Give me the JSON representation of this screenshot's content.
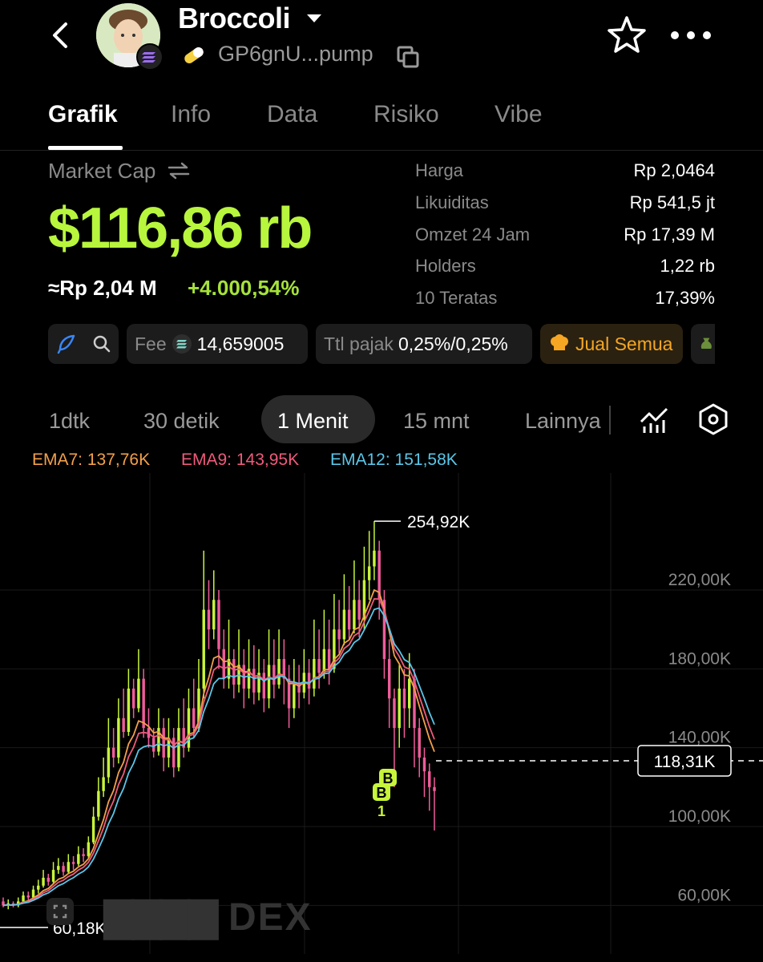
{
  "header": {
    "title": "Broccoli",
    "address": "GP6gnU...pump",
    "icons": {
      "back": "chevron-left-icon",
      "star": "star-icon",
      "more": "more-horizontal-icon",
      "copy": "copy-icon",
      "pill": "pill-icon"
    }
  },
  "tabs": [
    {
      "label": "Grafik",
      "active": true
    },
    {
      "label": "Info"
    },
    {
      "label": "Data"
    },
    {
      "label": "Risiko"
    },
    {
      "label": "Vibe"
    }
  ],
  "market": {
    "label": "Market Cap",
    "value": "$116,86 rb",
    "idr": "≈Rp 2,04 M",
    "change": "+4.000,54%"
  },
  "stats": [
    {
      "key": "Harga",
      "value": "Rp 2,0464"
    },
    {
      "key": "Likuiditas",
      "value": "Rp 541,5 jt"
    },
    {
      "key": "Omzet 24 Jam",
      "value": "Rp 17,39 M"
    },
    {
      "key": "Holders",
      "value": "1,22 rb"
    },
    {
      "key": "10 Teratas",
      "value": "17,39%"
    }
  ],
  "chips": {
    "fee_label": "Fee",
    "fee_value": "14,659005",
    "tax_label": "Ttl pajak",
    "tax_value": "0,25%/0,25%",
    "sell_all": "Jual Semua"
  },
  "timeframes": [
    {
      "label": "1dtk"
    },
    {
      "label": "30 detik"
    },
    {
      "label": "1 Menit",
      "active": true
    },
    {
      "label": "15 mnt"
    },
    {
      "label": "Lainnya"
    }
  ],
  "ema": {
    "ema7": "EMA7: 137,76K",
    "ema9": "EMA9: 143,95K",
    "ema12": "EMA12: 151,58K"
  },
  "colors": {
    "accent": "#b8f53d",
    "up": "#c7f53a",
    "down": "#ef5c9a",
    "ema7": "#f3a04a",
    "ema9": "#ef5a7c",
    "ema12": "#5bc6e8",
    "sell": "#f5a623"
  },
  "watermark": "DEX",
  "chart_data": {
    "type": "candlestick",
    "title": "",
    "yticks": [
      "220,00K",
      "180,00K",
      "140,00K",
      "100,00K",
      "60,00K"
    ],
    "ytick_values": [
      220000,
      180000,
      140000,
      100000,
      60000
    ],
    "ylim": [
      40000,
      265000
    ],
    "high_label": "254,92K",
    "high_value": 254920,
    "low_label": "60,18K",
    "low_value": 60180,
    "current_label": "118,31K",
    "current_value": 118310,
    "markers": [
      "B",
      "B"
    ],
    "marker_caption": "1",
    "series": [
      {
        "name": "EMA7",
        "last": "137,76K"
      },
      {
        "name": "EMA9",
        "last": "143,95K"
      },
      {
        "name": "EMA12",
        "last": "151,58K"
      }
    ],
    "candles": [
      [
        62,
        60,
        64,
        59
      ],
      [
        60,
        61,
        63,
        58
      ],
      [
        61,
        60,
        62,
        59
      ],
      [
        60,
        62,
        64,
        59
      ],
      [
        62,
        65,
        67,
        61
      ],
      [
        65,
        64,
        67,
        62
      ],
      [
        64,
        68,
        70,
        63
      ],
      [
        68,
        70,
        73,
        66
      ],
      [
        70,
        74,
        78,
        69
      ],
      [
        74,
        72,
        76,
        70
      ],
      [
        72,
        78,
        82,
        71
      ],
      [
        78,
        80,
        84,
        76
      ],
      [
        80,
        77,
        82,
        75
      ],
      [
        77,
        82,
        86,
        76
      ],
      [
        82,
        81,
        85,
        78
      ],
      [
        81,
        86,
        90,
        80
      ],
      [
        86,
        85,
        89,
        82
      ],
      [
        85,
        92,
        95,
        84
      ],
      [
        92,
        105,
        110,
        91
      ],
      [
        105,
        118,
        125,
        103
      ],
      [
        118,
        125,
        135,
        115
      ],
      [
        125,
        140,
        155,
        122
      ],
      [
        140,
        135,
        150,
        130
      ],
      [
        135,
        155,
        165,
        132
      ],
      [
        155,
        148,
        170,
        145
      ],
      [
        148,
        170,
        180,
        146
      ],
      [
        170,
        160,
        175,
        155
      ],
      [
        160,
        175,
        190,
        158
      ],
      [
        175,
        150,
        180,
        145
      ],
      [
        150,
        145,
        160,
        140
      ],
      [
        145,
        138,
        150,
        135
      ],
      [
        138,
        150,
        160,
        136
      ],
      [
        150,
        135,
        155,
        128
      ],
      [
        135,
        145,
        155,
        130
      ],
      [
        145,
        130,
        150,
        125
      ],
      [
        130,
        150,
        160,
        128
      ],
      [
        150,
        140,
        165,
        135
      ],
      [
        140,
        160,
        170,
        138
      ],
      [
        160,
        150,
        175,
        145
      ],
      [
        150,
        170,
        185,
        148
      ],
      [
        170,
        210,
        240,
        165
      ],
      [
        210,
        200,
        225,
        190
      ],
      [
        200,
        215,
        230,
        195
      ],
      [
        215,
        190,
        220,
        180
      ],
      [
        190,
        175,
        200,
        170
      ],
      [
        175,
        185,
        205,
        170
      ],
      [
        185,
        172,
        190,
        165
      ],
      [
        172,
        182,
        200,
        168
      ],
      [
        182,
        170,
        190,
        160
      ],
      [
        170,
        180,
        195,
        165
      ],
      [
        180,
        168,
        192,
        162
      ],
      [
        168,
        178,
        190,
        164
      ],
      [
        178,
        165,
        185,
        158
      ],
      [
        165,
        182,
        200,
        160
      ],
      [
        182,
        172,
        195,
        165
      ],
      [
        172,
        185,
        200,
        170
      ],
      [
        185,
        175,
        195,
        162
      ],
      [
        175,
        160,
        182,
        150
      ],
      [
        160,
        172,
        185,
        155
      ],
      [
        172,
        168,
        182,
        160
      ],
      [
        168,
        178,
        190,
        165
      ],
      [
        178,
        170,
        185,
        162
      ],
      [
        170,
        185,
        205,
        166
      ],
      [
        185,
        178,
        200,
        170
      ],
      [
        178,
        190,
        210,
        175
      ],
      [
        190,
        180,
        205,
        172
      ],
      [
        180,
        200,
        218,
        178
      ],
      [
        200,
        195,
        215,
        188
      ],
      [
        195,
        210,
        228,
        192
      ],
      [
        210,
        200,
        222,
        195
      ],
      [
        200,
        215,
        235,
        198
      ],
      [
        215,
        205,
        225,
        196
      ],
      [
        205,
        225,
        242,
        200
      ],
      [
        225,
        232,
        250,
        215
      ],
      [
        232,
        240,
        254.92,
        225
      ],
      [
        240,
        215,
        245,
        205
      ],
      [
        215,
        185,
        220,
        175
      ],
      [
        185,
        165,
        195,
        150
      ],
      [
        165,
        150,
        170,
        120
      ],
      [
        150,
        170,
        182,
        140
      ],
      [
        170,
        160,
        180,
        145
      ],
      [
        160,
        175,
        188,
        150
      ],
      [
        175,
        150,
        180,
        130
      ],
      [
        150,
        135,
        155,
        125
      ],
      [
        135,
        128,
        140,
        115
      ],
      [
        128,
        120,
        132,
        108
      ],
      [
        120,
        118,
        125,
        98
      ]
    ]
  }
}
